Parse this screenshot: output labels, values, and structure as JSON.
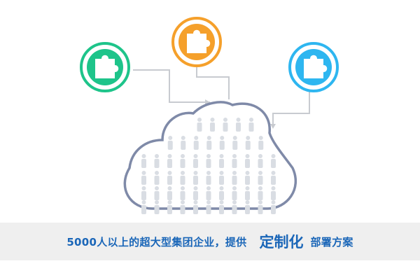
{
  "banner": {
    "main_text": "5000人以上的超大型集团企业，提供",
    "highlight_text": "定制化",
    "tail_text": "部署方案"
  },
  "colors": {
    "green": "#1ec48a",
    "orange": "#f5a02b",
    "blue": "#2eb6f0",
    "cloud_outline": "#7f8aa8",
    "people": "#d9dde3",
    "connector": "#c8cbd0",
    "banner_text": "#1a66b8",
    "banner_bg": "#efefef"
  },
  "icons": [
    {
      "name": "puzzle-piece-icon",
      "color_key": "green"
    },
    {
      "name": "puzzle-piece-icon",
      "color_key": "orange"
    },
    {
      "name": "puzzle-piece-icon",
      "color_key": "blue"
    }
  ],
  "crowd": {
    "rows": [
      {
        "count": 5
      },
      {
        "count": 8
      },
      {
        "count": 11
      },
      {
        "count": 11
      },
      {
        "count": 11
      },
      {
        "count": 11
      }
    ]
  }
}
